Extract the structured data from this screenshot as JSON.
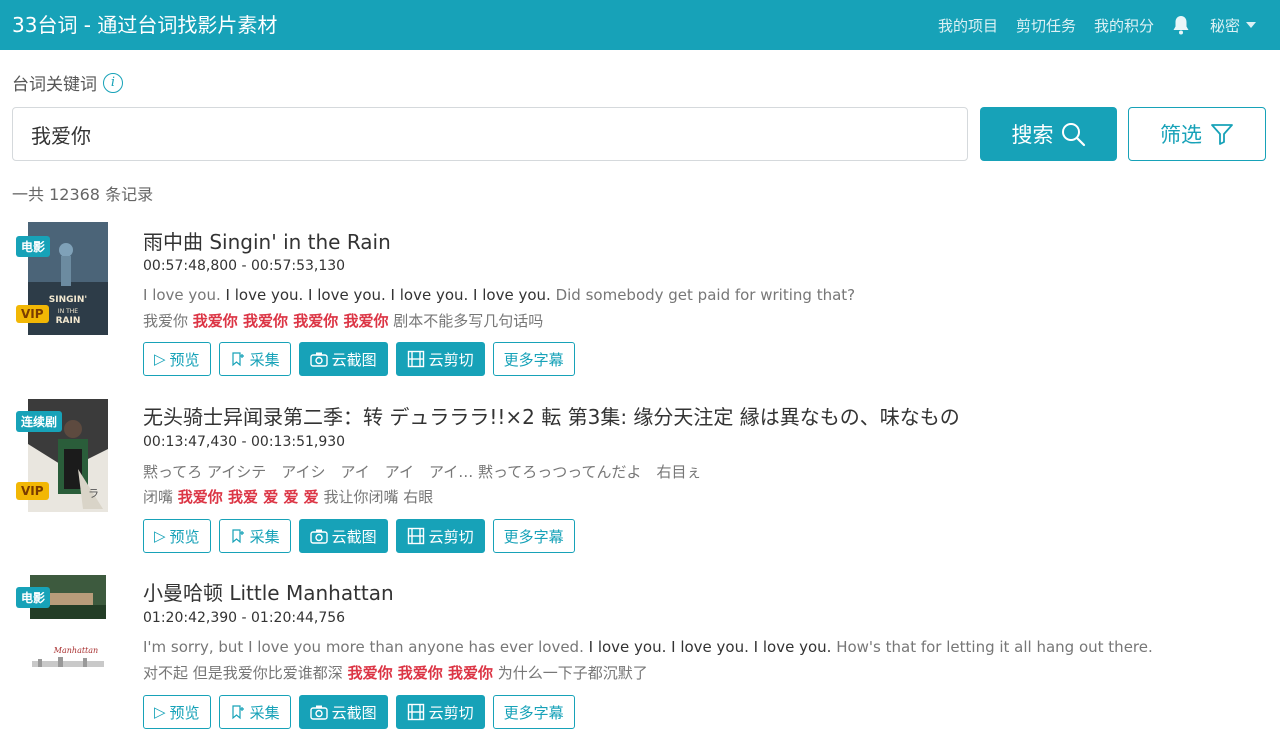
{
  "header": {
    "brand": "33台词 - 通过台词找影片素材",
    "nav": [
      "我的项目",
      "剪切任务",
      "我的积分"
    ],
    "user": "秘密"
  },
  "search": {
    "label": "台词关键词",
    "value": "我爱你",
    "search_button": "搜索",
    "filter_button": "筛选",
    "count_text": "一共 12368 条记录"
  },
  "colors": {
    "accent": "#17a2b8",
    "highlight": "#dc3545",
    "vip": "#f2b705"
  },
  "actions": {
    "preview": "预览",
    "collect": "采集",
    "screenshot": "云截图",
    "cut": "云剪切",
    "more": "更多字幕"
  },
  "results": [
    {
      "type": "电影",
      "vip": "VIP",
      "title": "雨中曲 Singin' in the Rain",
      "time": "00:57:48,800 - 00:57:53,130",
      "en": [
        "I love you.",
        "I love you. I love you. I love you. I love you.",
        "Did somebody get paid for writing that?"
      ],
      "cn": [
        "我爱你",
        "我爱你 我爱你 我爱你 我爱你",
        "剧本不能多写几句话吗"
      ]
    },
    {
      "type": "连续剧",
      "vip": "VIP",
      "title": "无头骑士异闻录第二季：转 デュラララ!!×2 転 第3集: 缘分天注定 縁は異なもの、味なもの",
      "time": "00:13:47,430 - 00:13:51,930",
      "en": [
        "黙ってろ アイシテ　アイシ　アイ　アイ　アイ… 黙ってろっつってんだよ　右目ぇ",
        "",
        ""
      ],
      "cn": [
        "闭嘴",
        "我爱你 我爱 爱 爱 爱",
        "我让你闭嘴 右眼"
      ]
    },
    {
      "type": "电影",
      "vip": "",
      "title": "小曼哈顿 Little Manhattan",
      "time": "01:20:42,390 - 01:20:44,756",
      "en": [
        "I'm sorry, but I love you more than anyone has ever loved.",
        "I love you. I love you. I love you.",
        "How's that for letting it all hang out there."
      ],
      "cn": [
        "对不起 但是我爱你比爱谁都深",
        "我爱你 我爱你 我爱你",
        "为什么一下子都沉默了"
      ]
    }
  ]
}
